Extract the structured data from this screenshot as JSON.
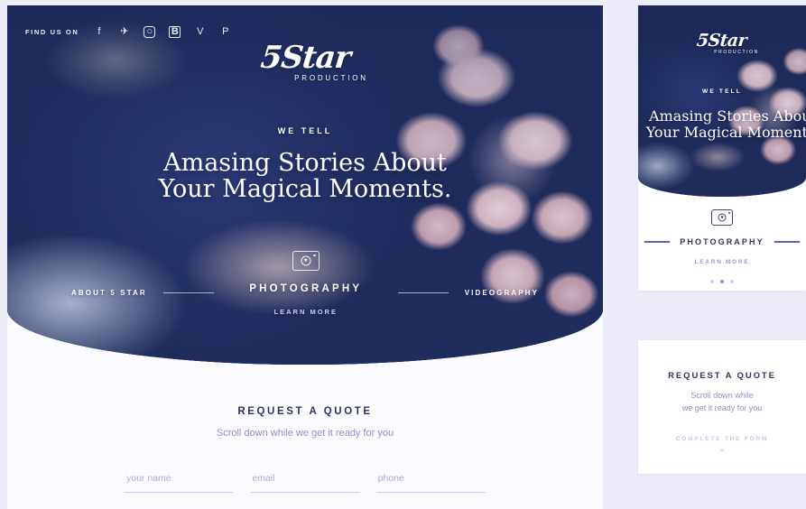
{
  "desktop": {
    "topbar": {
      "label": "FIND US ON",
      "social": [
        {
          "name": "facebook-icon",
          "glyph": "f"
        },
        {
          "name": "twitter-icon",
          "glyph": "✈"
        },
        {
          "name": "instagram-icon",
          "glyph": "◎"
        },
        {
          "name": "behance-icon",
          "glyph": "B"
        },
        {
          "name": "vimeo-icon",
          "glyph": "V"
        },
        {
          "name": "pinterest-icon",
          "glyph": "P"
        }
      ]
    },
    "logo": {
      "mark": "5Star",
      "sub": "PRODUCTION"
    },
    "hero": {
      "eyebrow": "WE TELL",
      "headline_line1": "Amasing Stories About",
      "headline_line2": "Your Magical Moments.",
      "nav_left": "ABOUT 5 STAR",
      "nav_right": "VIDEOGRAPHY",
      "nav_center": "PHOTOGRAPHY",
      "learn_more": "LEARN MORE",
      "camera_icon": "camera-heart-icon",
      "heart_glyph": "♥"
    },
    "quote": {
      "title": "REQUEST A QUOTE",
      "subtitle": "Scroll down while we get it ready for you",
      "fields": [
        {
          "name": "your-name",
          "placeholder": "your name",
          "value": ""
        },
        {
          "name": "email",
          "placeholder": "email",
          "value": ""
        },
        {
          "name": "phone",
          "placeholder": "phone",
          "value": ""
        }
      ]
    }
  },
  "mobile": {
    "logo": {
      "mark": "5Star",
      "sub": "PRODUCTION"
    },
    "hero": {
      "eyebrow": "WE TELL",
      "headline_line1": "Amasing Stories About",
      "headline_line2": "Your Magical Moments."
    },
    "section": {
      "title": "PHOTOGRAPHY",
      "learn_more": "LEARN MORE",
      "camera_icon": "camera-heart-icon",
      "heart_glyph": "♥",
      "dots": 3,
      "active_dot": 1
    },
    "quote": {
      "title": "REQUEST A QUOTE",
      "subtitle_line1": "Scroll down while",
      "subtitle_line2": "we get it ready for you",
      "cta": "COMPLETE THE FORM",
      "chevron": "⌄"
    }
  },
  "colors": {
    "page_bg": "#edeef9",
    "panel_bg": "#fafaff",
    "navy": "#2c3560",
    "periwinkle": "#8b93c8",
    "rule": "#c9cfef",
    "dot_active": "#8c97d9"
  }
}
